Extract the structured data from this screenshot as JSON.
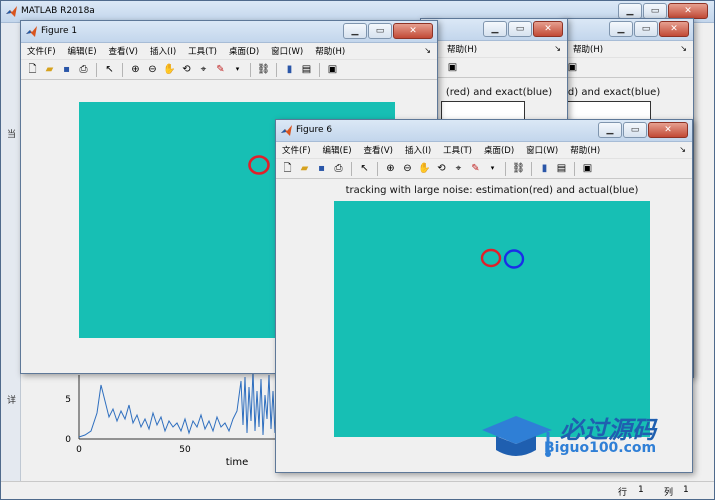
{
  "main_window": {
    "title": "MATLAB R2018a",
    "status": {
      "row_label": "行",
      "row_value": "1",
      "col_label": "列",
      "col_value": "1"
    },
    "side_glyphs": [
      "当",
      "详"
    ]
  },
  "background_plot": {
    "xlabel": "time",
    "y_ticks": [
      "5",
      "0"
    ],
    "x_ticks": [
      "0",
      "50"
    ]
  },
  "figure_menu": [
    "文件(F)",
    "编辑(E)",
    "查看(V)",
    "插入(I)",
    "工具(T)",
    "桌面(D)",
    "窗口(W)",
    "帮助(H)"
  ],
  "menu_arrow": "↘",
  "back_figures": {
    "menu_help": "帮助(H)",
    "title_a": "(red) and exact(blue)",
    "title_b": "ed) and exact(blue)"
  },
  "figure1": {
    "title": "Figure 1"
  },
  "figure6": {
    "title": "Figure 6",
    "plot_title": "tracking with large noise: estimation(red) and actual(blue)"
  },
  "colors": {
    "axes_bg": "#17bfb4",
    "estimate": "#e0202a",
    "actual": "#1a2ee8",
    "series_line": "#2f6fbf"
  },
  "icons": [
    "matlab-icon",
    "figure-icon",
    "minimize-icon",
    "maximize-icon",
    "close-icon",
    "new-icon",
    "open-icon",
    "save-icon",
    "print-icon",
    "pointer-icon",
    "zoom-in-icon",
    "zoom-out-icon",
    "pan-icon",
    "rotate-icon",
    "datatip-icon",
    "brush-icon",
    "link-icon",
    "colorbar-icon",
    "legend-icon",
    "hide-tools-icon",
    "dock-icon"
  ],
  "watermark": {
    "brand_cn": "必过源码",
    "brand_url": "Biguo100.com"
  }
}
